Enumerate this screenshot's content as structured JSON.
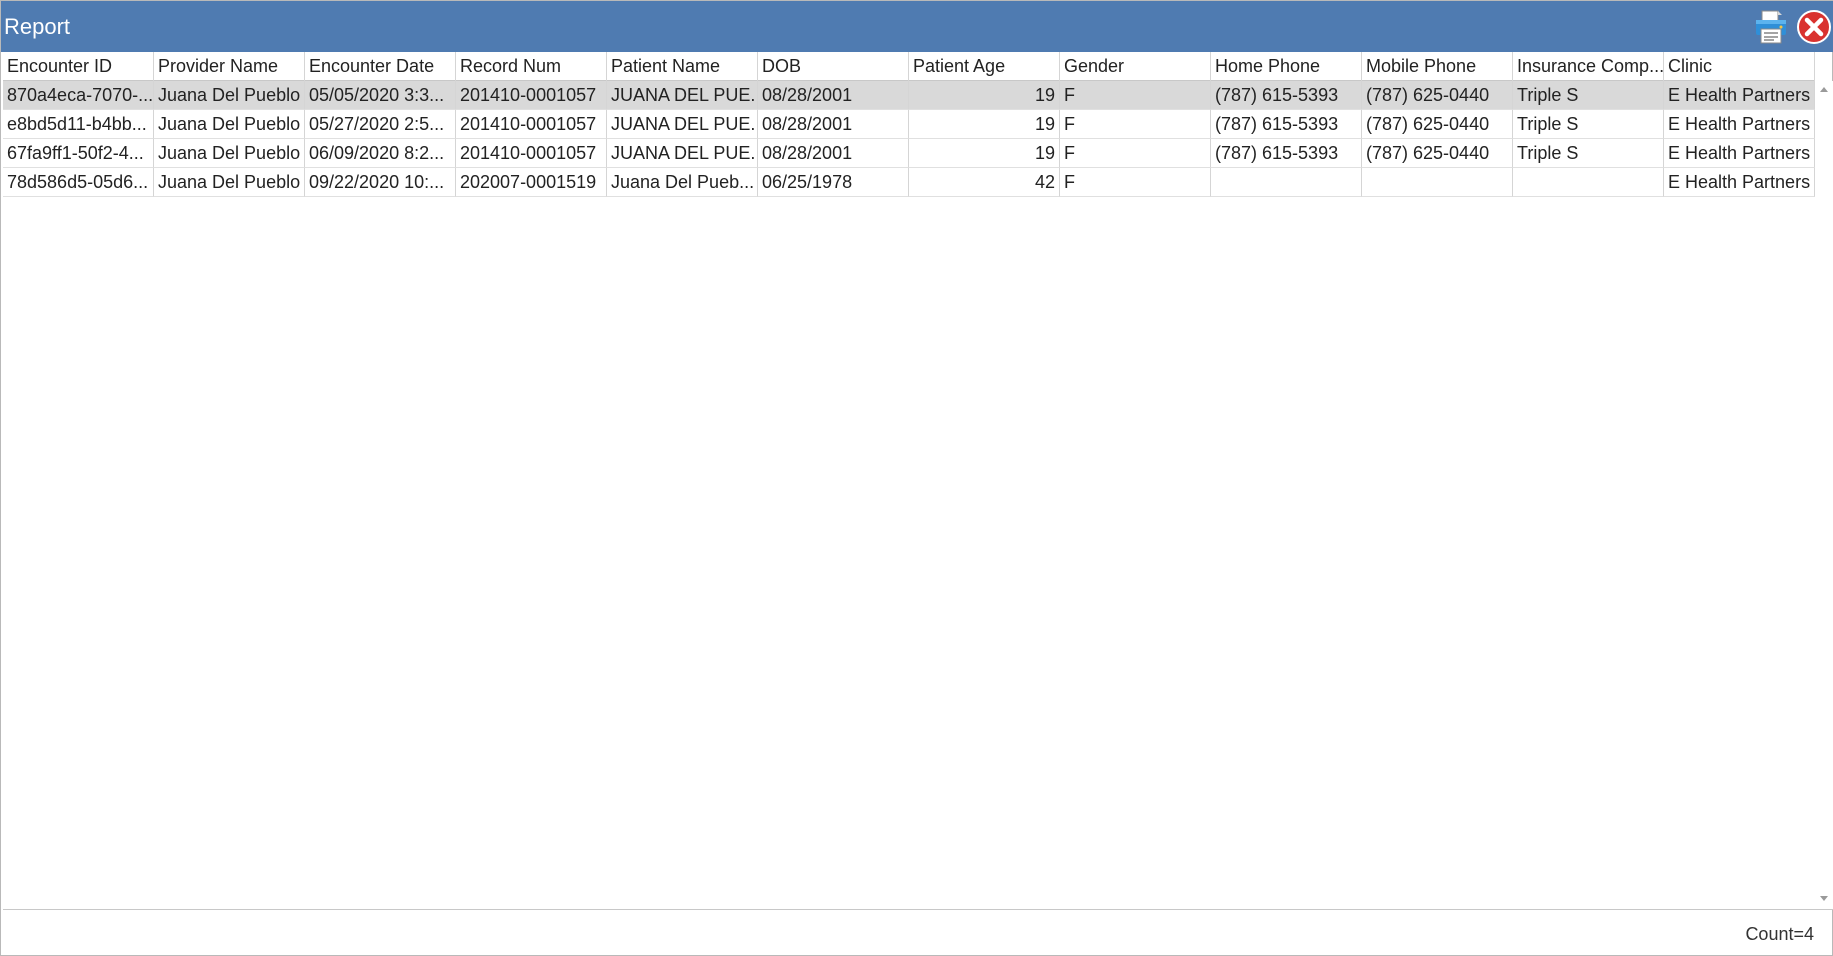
{
  "window": {
    "title": "Report",
    "titlebar_color": "#4f7bb1",
    "icons": [
      "printer-icon",
      "close-icon"
    ]
  },
  "table": {
    "columns": [
      "Encounter ID",
      "Provider Name",
      "Encounter Date",
      "Record Num",
      "Patient Name",
      "DOB",
      "Patient Age",
      "Gender",
      "Home Phone",
      "Mobile Phone",
      "Insurance Comp...",
      "Clinic"
    ],
    "rows": [
      [
        "870a4eca-7070-...",
        "Juana Del Pueblo",
        "05/05/2020 3:3...",
        "201410-0001057",
        "JUANA DEL PUE...",
        "08/28/2001",
        "19",
        "F",
        "(787) 615-5393",
        "(787) 625-0440",
        "Triple S",
        "E Health Partners"
      ],
      [
        "e8bd5d11-b4bb...",
        "Juana Del Pueblo",
        "05/27/2020 2:5...",
        "201410-0001057",
        "JUANA DEL PUE...",
        "08/28/2001",
        "19",
        "F",
        "(787) 615-5393",
        "(787) 625-0440",
        "Triple S",
        "E Health Partners"
      ],
      [
        "67fa9ff1-50f2-4...",
        "Juana Del Pueblo",
        "06/09/2020 8:2...",
        "201410-0001057",
        "JUANA DEL PUE...",
        "08/28/2001",
        "19",
        "F",
        "(787) 615-5393",
        "(787) 625-0440",
        "Triple S",
        "E Health Partners"
      ],
      [
        "78d586d5-05d6...",
        "Juana Del Pueblo",
        "09/22/2020 10:...",
        "202007-0001519",
        "Juana  Del Pueb...",
        "06/25/1978",
        "42",
        "F",
        "",
        "",
        "",
        "E Health Partners"
      ]
    ],
    "selected_row": 0,
    "selected_color": "#d9d9d9"
  },
  "footer": {
    "count_text": "Count=4"
  }
}
